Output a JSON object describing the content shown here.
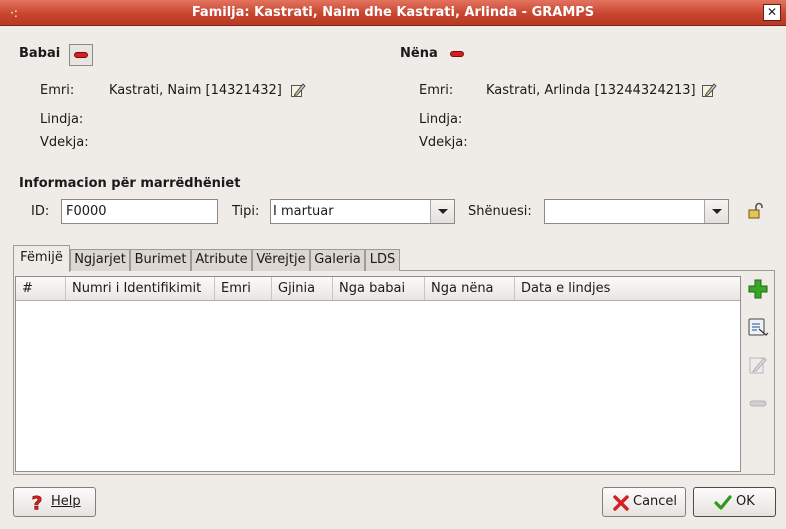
{
  "window": {
    "title": "Familja: Kastrati, Naim dhe Kastrati, Arlinda - GRAMPS",
    "menu_glyph": "·:",
    "close_glyph": "✕"
  },
  "father": {
    "heading": "Babai",
    "name_label": "Emri:",
    "name_value": "Kastrati, Naim [14321432]",
    "birth_label": "Lindja:",
    "death_label": "Vdekja:"
  },
  "mother": {
    "heading": "Nëna",
    "name_label": "Emri:",
    "name_value": "Kastrati, Arlinda [13244324213]",
    "birth_label": "Lindja:",
    "death_label": "Vdekja:"
  },
  "relationship": {
    "heading": "Informacion për marrëdhëniet",
    "id_label": "ID:",
    "id_value": "F0000",
    "type_label": "Tipi:",
    "type_value": "I martuar",
    "marker_label": "Shënuesi:",
    "marker_value": ""
  },
  "tabs": [
    {
      "label": "Fëmijë"
    },
    {
      "label": "Ngjarjet"
    },
    {
      "label": "Burimet"
    },
    {
      "label": "Atribute"
    },
    {
      "label": "Vërejtje"
    },
    {
      "label": "Galeria"
    },
    {
      "label": "LDS"
    }
  ],
  "children_table": {
    "columns": [
      "#",
      "Numri i Identifikimit",
      "Emri",
      "Gjinia",
      "Nga babai",
      "Nga nëna",
      "Data e lindjes"
    ]
  },
  "buttons": {
    "help": "Help",
    "cancel": "Cancel",
    "ok": "OK"
  },
  "colors": {
    "titlebar": "#c9452f",
    "remove": "#d32020",
    "add": "#2e9a1c"
  }
}
